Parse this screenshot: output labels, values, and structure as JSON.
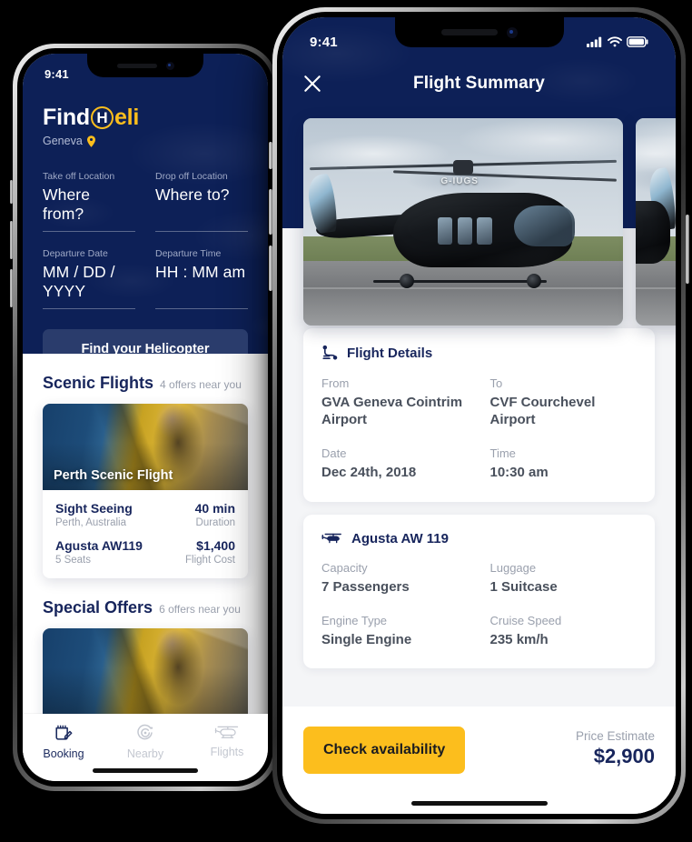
{
  "theme": {
    "navy": "#0d2057",
    "navy_text": "#17255c",
    "yellow": "#fcbe1d",
    "muted": "#9aa0ad",
    "button_navy": "#2a3c6c",
    "page_background": "#000000"
  },
  "left_phone": {
    "status_bar": {
      "time": "9:41"
    },
    "logo": {
      "find": "Find",
      "h": "H",
      "eli": "eli",
      "pin_icon": "location-pin-icon"
    },
    "city": "Geneva",
    "search_form": {
      "fields": [
        {
          "label": "Take off Location",
          "value": "Where from?",
          "placeholder": "Where from?"
        },
        {
          "label": "Drop off Location",
          "value": "Where to?",
          "placeholder": "Where to?"
        },
        {
          "label": "Departure Date",
          "value": "MM / DD / YYYY",
          "placeholder": "MM / DD / YYYY"
        },
        {
          "label": "Departure Time",
          "value": "HH : MM am",
          "placeholder": "HH : MM am"
        }
      ],
      "submit_label": "Find your Helicopter"
    },
    "sections": [
      {
        "title": "Scenic Flights",
        "subtitle": "4 offers near you",
        "card": {
          "photo_title": "Perth Scenic Flight",
          "name": "Sight Seeing",
          "location": "Perth, Australia",
          "duration_value": "40 min",
          "duration_label": "Duration",
          "aircraft": "Agusta AW119",
          "seats": "5 Seats",
          "price": "$1,400",
          "price_label": "Flight Cost"
        }
      },
      {
        "title": "Special Offers",
        "subtitle": "6 offers near you"
      }
    ],
    "tab_bar": [
      {
        "label": "Booking",
        "icon": "calendar-edit-icon",
        "active": true
      },
      {
        "label": "Nearby",
        "icon": "radar-icon",
        "active": false
      },
      {
        "label": "Flights",
        "icon": "helicopter-icon",
        "active": false
      }
    ]
  },
  "right_phone": {
    "status_bar": {
      "time": "9:41",
      "icons": [
        "cellular-signal-icon",
        "wifi-icon",
        "battery-icon"
      ]
    },
    "nav": {
      "close_icon": "close-icon",
      "title": "Flight Summary"
    },
    "photo": {
      "tail_number": "G-IUGS",
      "alt_name": "helicopter-photo"
    },
    "flight_details": {
      "icon": "route-pin-icon",
      "title": "Flight Details",
      "pairs": [
        {
          "label": "From",
          "value": "GVA Geneva Cointrim Airport"
        },
        {
          "label": "To",
          "value": "CVF Courchevel Airport"
        },
        {
          "label": "Date",
          "value": "Dec 24th, 2018"
        },
        {
          "label": "Time",
          "value": "10:30 am"
        }
      ]
    },
    "aircraft_specs": {
      "icon": "helicopter-icon",
      "title": "Agusta AW 119",
      "pairs": [
        {
          "label": "Capacity",
          "value": "7 Passengers"
        },
        {
          "label": "Luggage",
          "value": "1 Suitcase"
        },
        {
          "label": "Engine Type",
          "value": "Single Engine"
        },
        {
          "label": "Cruise Speed",
          "value": "235 km/h"
        }
      ]
    },
    "footer": {
      "cta_label": "Check availability",
      "price_label": "Price Estimate",
      "price_value": "$2,900"
    }
  }
}
